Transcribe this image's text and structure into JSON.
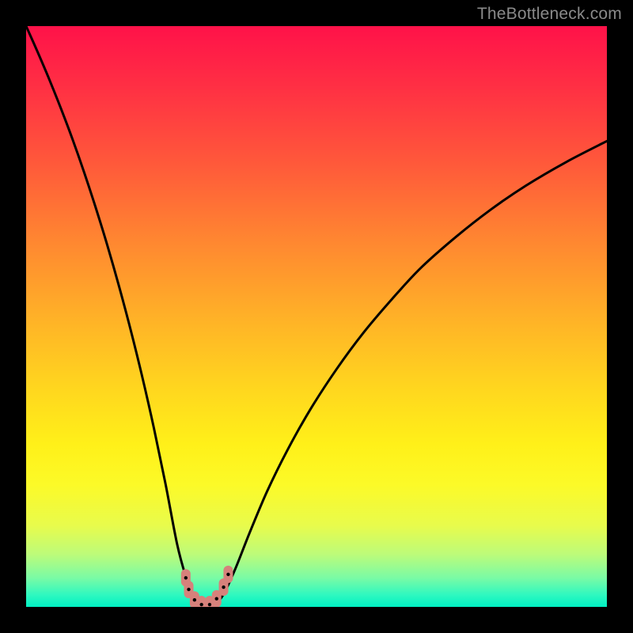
{
  "watermark": "TheBottleneck.com",
  "chart_data": {
    "type": "line",
    "title": "",
    "xlabel": "",
    "ylabel": "",
    "xlim": [
      0,
      100
    ],
    "ylim": [
      0,
      100
    ],
    "grid": false,
    "series": [
      {
        "name": "bottleneck-curve",
        "x": [
          0,
          2,
          4,
          6,
          8,
          10,
          12,
          14,
          16,
          18,
          20,
          22,
          24,
          26,
          27.5,
          28.7,
          30,
          31.3,
          32.6,
          34,
          36,
          38.5,
          41.5,
          45,
          49,
          53.5,
          58,
          63,
          68,
          74,
          80,
          86,
          93,
          100
        ],
        "y": [
          100,
          95.5,
          90.8,
          85.8,
          80.5,
          74.8,
          68.7,
          62.2,
          55.2,
          47.7,
          39.6,
          30.8,
          21.2,
          10.8,
          5.2,
          2.1,
          0.5,
          0.2,
          0.6,
          2.2,
          6.5,
          12.8,
          19.9,
          27,
          34.1,
          41,
          47.1,
          53,
          58.4,
          63.7,
          68.4,
          72.5,
          76.6,
          80.2
        ]
      }
    ],
    "markers": [
      {
        "x": 27.5,
        "y": 5.0
      },
      {
        "x": 28.0,
        "y": 3.0
      },
      {
        "x": 29.0,
        "y": 1.2
      },
      {
        "x": 30.2,
        "y": 0.4
      },
      {
        "x": 31.6,
        "y": 0.4
      },
      {
        "x": 32.8,
        "y": 1.4
      },
      {
        "x": 34.0,
        "y": 3.4
      },
      {
        "x": 34.8,
        "y": 5.6
      }
    ],
    "background_gradient": {
      "top": "#ff1249",
      "mid": "#fff019",
      "bottom": "#00f0c2"
    }
  }
}
